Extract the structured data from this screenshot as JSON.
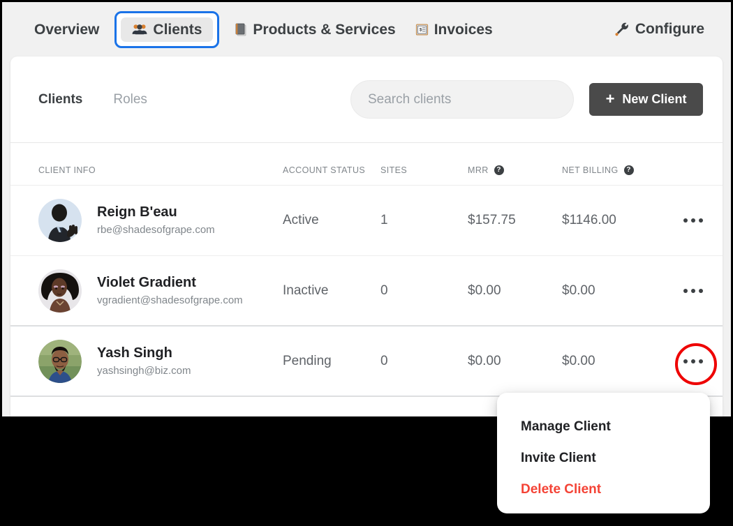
{
  "topnav": {
    "items": [
      {
        "label": "Overview",
        "icon": null,
        "active": false
      },
      {
        "label": "Clients",
        "icon": "people-icon",
        "active": true
      },
      {
        "label": "Products & Services",
        "icon": "products-icon",
        "active": false
      },
      {
        "label": "Invoices",
        "icon": "invoices-icon",
        "active": false
      }
    ],
    "configure": {
      "label": "Configure",
      "icon": "wrench-icon"
    }
  },
  "toolbar": {
    "subtabs": [
      {
        "label": "Clients",
        "active": true
      },
      {
        "label": "Roles",
        "active": false
      }
    ],
    "search": {
      "placeholder": "Search clients",
      "value": ""
    },
    "new_client_label": "New Client",
    "plus_glyph": "+"
  },
  "table": {
    "columns": [
      {
        "key": "client_info",
        "label": "CLIENT INFO",
        "help": false
      },
      {
        "key": "account_status",
        "label": "ACCOUNT STATUS",
        "help": false
      },
      {
        "key": "sites",
        "label": "SITES",
        "help": false
      },
      {
        "key": "mrr",
        "label": "MRR",
        "help": true
      },
      {
        "key": "net_billing",
        "label": "NET BILLING",
        "help": true
      }
    ],
    "help_glyph": "?",
    "rows": [
      {
        "name": "Reign B'eau",
        "email": "rbe@shadesofgrape.com",
        "status": "Active",
        "sites": "1",
        "mrr": "$157.75",
        "net_billing": "$1146.00",
        "avatar": "photo-man-suit",
        "selected": false,
        "menu_open": false
      },
      {
        "name": "Violet Gradient",
        "email": "vgradient@shadesofgrape.com",
        "status": "Inactive",
        "sites": "0",
        "mrr": "$0.00",
        "net_billing": "$0.00",
        "avatar": "photo-woman-curly",
        "selected": false,
        "menu_open": false
      },
      {
        "name": "Yash Singh",
        "email": "yashsingh@biz.com",
        "status": "Pending",
        "sites": "0",
        "mrr": "$0.00",
        "net_billing": "$0.00",
        "avatar": "photo-man-glasses",
        "selected": true,
        "menu_open": true
      }
    ]
  },
  "dropdown": {
    "items": [
      {
        "label": "Manage Client",
        "danger": false
      },
      {
        "label": "Invite Client",
        "danger": false
      },
      {
        "label": "Delete Client",
        "danger": true
      }
    ]
  },
  "colors": {
    "focus_ring": "#1a73e8",
    "highlight_circle": "#ee0000",
    "danger_text": "#f44336",
    "primary_button": "#4a4a4a",
    "page_background": "#f1f1f1",
    "card_background": "#ffffff",
    "outer_background": "#000000"
  }
}
